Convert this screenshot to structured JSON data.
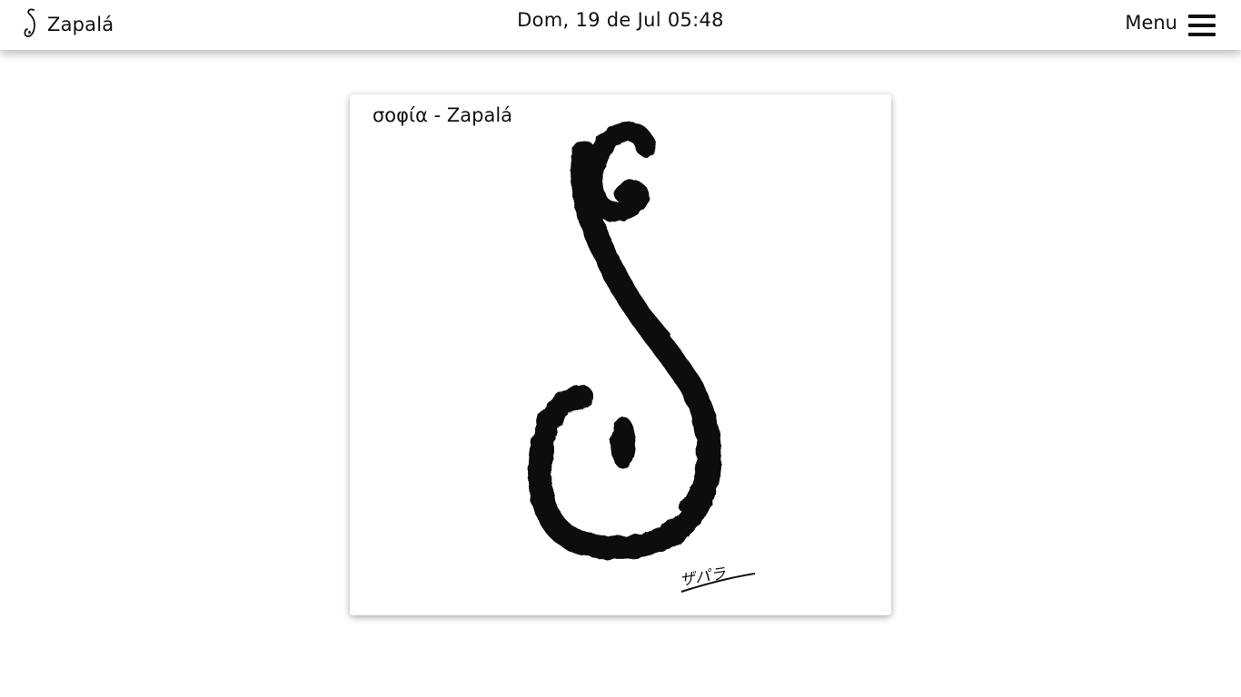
{
  "header": {
    "brand_name": "Zapalá",
    "logo_icon": "zapala-s-logo-icon",
    "datetime": "Dom, 19 de Jul 05:48",
    "menu_label": "Menu",
    "menu_icon": "hamburger-icon"
  },
  "card": {
    "title": "σοφία - Zapalá",
    "artwork_signature": "ザパラ"
  }
}
